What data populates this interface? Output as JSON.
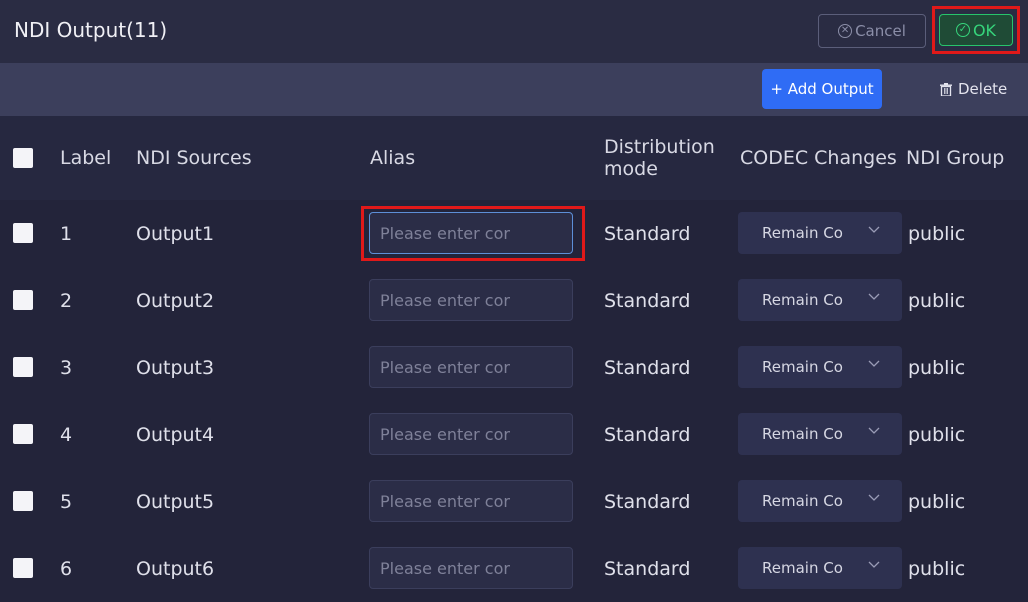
{
  "dialog": {
    "title": "NDI Output(11)",
    "cancel_label": "Cancel",
    "ok_label": "OK"
  },
  "toolbar": {
    "add_label": "+ Add Output",
    "delete_label": "Delete"
  },
  "table": {
    "columns": {
      "label": "Label",
      "sources": "NDI Sources",
      "alias": "Alias",
      "distribution_line1": "Distribution",
      "distribution_line2": "mode",
      "codec": "CODEC Changes",
      "group": "NDI Group"
    },
    "rows": [
      {
        "label": "1",
        "source": "Output1",
        "alias_placeholder": "Please enter cor",
        "alias_value": "",
        "mode": "Standard",
        "codec": "Remain Co",
        "group": "public"
      },
      {
        "label": "2",
        "source": "Output2",
        "alias_placeholder": "Please enter cor",
        "alias_value": "",
        "mode": "Standard",
        "codec": "Remain Co",
        "group": "public"
      },
      {
        "label": "3",
        "source": "Output3",
        "alias_placeholder": "Please enter cor",
        "alias_value": "",
        "mode": "Standard",
        "codec": "Remain Co",
        "group": "public"
      },
      {
        "label": "4",
        "source": "Output4",
        "alias_placeholder": "Please enter cor",
        "alias_value": "",
        "mode": "Standard",
        "codec": "Remain Co",
        "group": "public"
      },
      {
        "label": "5",
        "source": "Output5",
        "alias_placeholder": "Please enter cor",
        "alias_value": "",
        "mode": "Standard",
        "codec": "Remain Co",
        "group": "public"
      },
      {
        "label": "6",
        "source": "Output6",
        "alias_placeholder": "Please enter cor",
        "alias_value": "",
        "mode": "Standard",
        "codec": "Remain Co",
        "group": "public"
      }
    ]
  },
  "colors": {
    "accent_blue": "#2f6cf5",
    "ok_green": "#36d47b",
    "highlight_red": "#e01919",
    "background": "#23243a"
  },
  "icons": {
    "cancel": "circle-x-icon",
    "ok": "circle-check-icon",
    "delete": "trash-icon",
    "codec": "chevron-down-icon"
  }
}
